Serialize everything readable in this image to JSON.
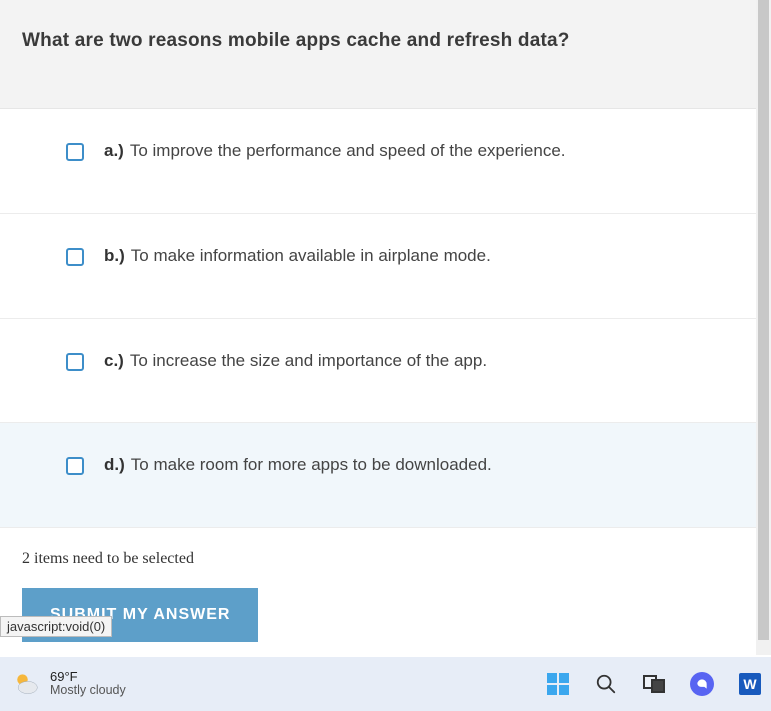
{
  "question": "What are two reasons mobile apps cache and refresh data?",
  "options": [
    {
      "prefix": "a.)",
      "text": "To improve the performance and speed of the experience."
    },
    {
      "prefix": "b.)",
      "text": "To make information available in airplane mode."
    },
    {
      "prefix": "c.)",
      "text": "To increase the size and importance of the app."
    },
    {
      "prefix": "d.)",
      "text": "To make room for more apps to be downloaded."
    }
  ],
  "instruction": "2 items need to be selected",
  "submit_label": "SUBMIT MY ANSWER",
  "status_tooltip": "javascript:void(0)",
  "taskbar": {
    "weather": {
      "temp": "69°F",
      "desc": "Mostly cloudy"
    },
    "word_letter": "W"
  }
}
